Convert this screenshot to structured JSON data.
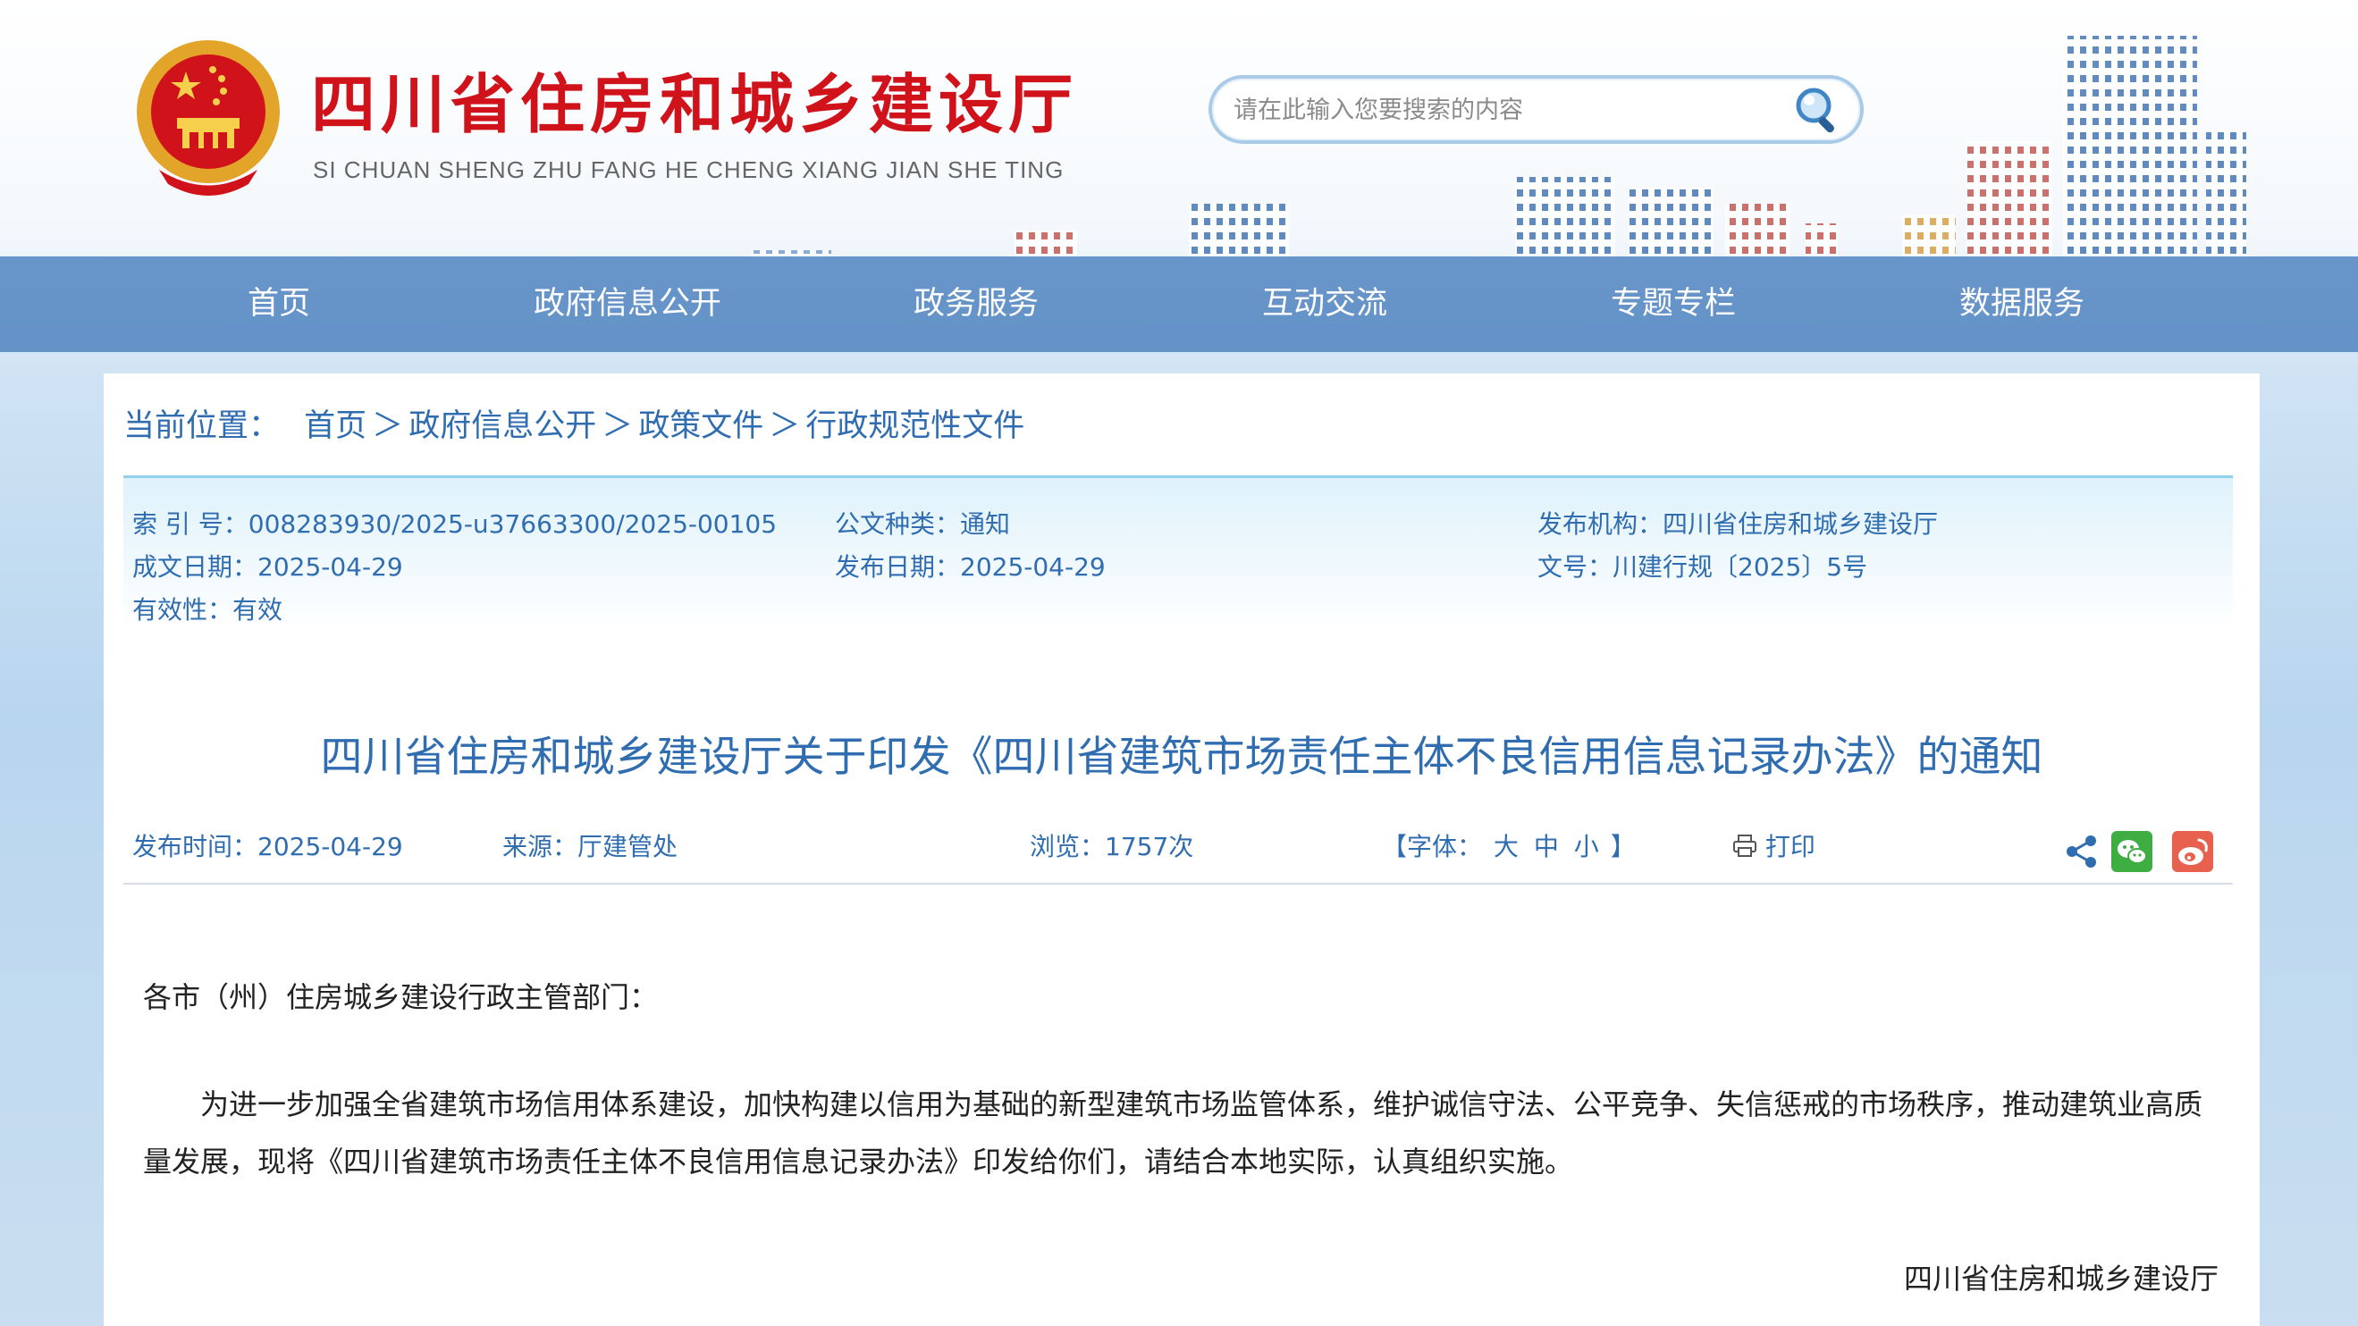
{
  "site": {
    "title": "四川省住房和城乡建设厅",
    "subtitle": "SI CHUAN SHENG ZHU FANG HE CHENG XIANG JIAN SHE TING"
  },
  "search": {
    "placeholder": "请在此输入您要搜索的内容",
    "value": ""
  },
  "nav": [
    "首页",
    "政府信息公开",
    "政务服务",
    "互动交流",
    "专题专栏",
    "数据服务"
  ],
  "breadcrumb": {
    "label": "当前位置：",
    "items": [
      "首页",
      "政府信息公开",
      "政策文件",
      "行政规范性文件"
    ],
    "separator": "＞"
  },
  "meta": {
    "index_no": "索 引 号：008283930/2025-u37663300/2025-00105",
    "doc_type": "公文种类：通知",
    "publisher": "发布机构：四川省住房和城乡建设厅",
    "written_date": "成文日期：2025-04-29",
    "publish_date": "发布日期：2025-04-29",
    "doc_no": "文号：川建行规〔2025〕5号",
    "validity": "有效性：有效"
  },
  "document": {
    "title": "四川省住房和城乡建设厅关于印发《四川省建筑市场责任主体不良信用信息记录办法》的通知",
    "publish_time": "发布时间：2025-04-29",
    "source": "来源：厅建管处",
    "views": "浏览：1757次",
    "font_label_open": "【字体：",
    "font_large": "大",
    "font_medium": "中",
    "font_small": "小",
    "font_label_close": "】",
    "print": "打印",
    "salutation": "各市（州）住房城乡建设行政主管部门：",
    "paragraph": "为进一步加强全省建筑市场信用体系建设，加快构建以信用为基础的新型建筑市场监管体系，维护诚信守法、公平竞争、失信惩戒的市场秩序，推动建筑业高质量发展，现将《四川省建筑市场责任主体不良信用信息记录办法》印发给你们，请结合本地实际，认真组织实施。",
    "signer": "四川省住房和城乡建设厅"
  },
  "colors": {
    "brand_red": "#d0121b",
    "link_blue": "#2f6db0",
    "nav_bg": "#4a80be",
    "wechat_green": "#3fae42",
    "weibo_red": "#e8614f"
  },
  "icons": [
    "national-emblem-icon",
    "search-icon",
    "print-icon",
    "share-icon",
    "wechat-icon",
    "weibo-icon"
  ]
}
